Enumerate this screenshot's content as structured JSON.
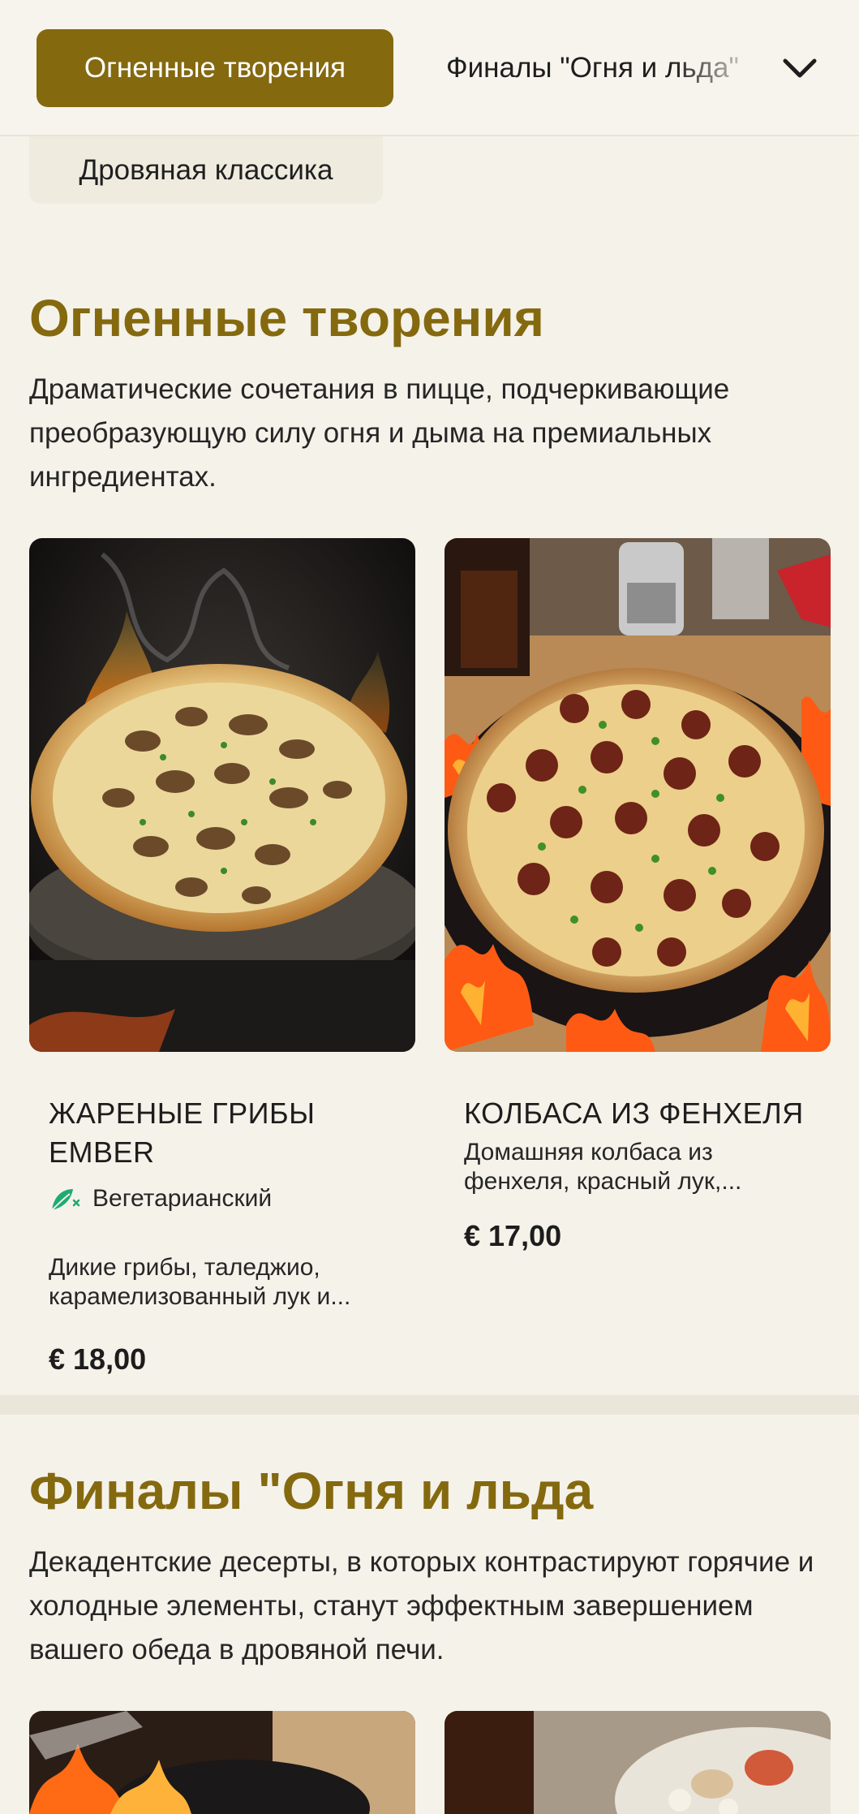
{
  "category_nav": {
    "active_label": "Огненные творения",
    "next_label": "Финалы \"Огня и льда\"",
    "secondary_label": "Дровяная классика",
    "expand_icon": "chevron-down-icon"
  },
  "sections": [
    {
      "title": "Огненные творения",
      "description": "Драматические сочетания в пицце, подчеркивающие преобразующую силу огня и дыма на премиальных ингредиентах.",
      "items": [
        {
          "name": "ЖАРЕНЫЕ ГРИБЫ EMBER",
          "badge": "Вегетарианский",
          "badge_icon": "vegetarian-leaf-icon",
          "description": "Дикие грибы, таледжио, карамелизованный лук и...",
          "price": "€ 18,00"
        },
        {
          "name": "КОЛБАСА ИЗ ФЕНХЕЛЯ",
          "description": "Домашняя колбаса из фенхеля, красный лук,...",
          "price": "€ 17,00"
        }
      ]
    },
    {
      "title": "Финалы \"Огня и льда",
      "description": "Декадентские десерты, в которых контрастируют горячие и холодные элементы, станут эффектным завершением вашего обеда в дровяной печи."
    }
  ],
  "colors": {
    "accent": "#84690f",
    "background": "#f5f2ea",
    "vegetarian": "#1faa72"
  }
}
